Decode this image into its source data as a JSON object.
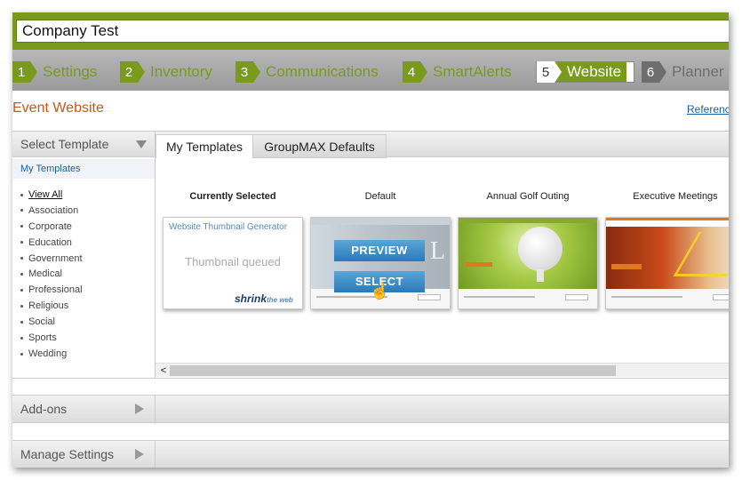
{
  "company": {
    "value": "Company Test"
  },
  "steps": [
    {
      "num": "1",
      "label": "Settings"
    },
    {
      "num": "2",
      "label": "Inventory"
    },
    {
      "num": "3",
      "label": "Communications"
    },
    {
      "num": "4",
      "label": "SmartAlerts"
    },
    {
      "num": "5",
      "label": "Website"
    },
    {
      "num": "6",
      "label": "Planner"
    }
  ],
  "page": {
    "title": "Event Website",
    "reference_link": "Reference"
  },
  "left_panel": {
    "header": "Select Template",
    "subheader": "My Templates",
    "categories": [
      "View All",
      "Association",
      "Corporate",
      "Education",
      "Government",
      "Medical",
      "Professional",
      "Religious",
      "Social",
      "Sports",
      "Wedding"
    ]
  },
  "tabs": [
    {
      "label": "My Templates"
    },
    {
      "label": "GroupMAX Defaults"
    }
  ],
  "templates": [
    {
      "label": "Currently Selected",
      "thumb_title": "Website Thumbnail Generator",
      "thumb_status": "Thumbnail queued",
      "logo_main": "shrink",
      "logo_sub": "the web"
    },
    {
      "label": "Default",
      "letter": "L",
      "preview_label": "PREVIEW",
      "select_label": "SELECT"
    },
    {
      "label": "Annual Golf Outing"
    },
    {
      "label": "Executive Meetings"
    }
  ],
  "scrollbar": {
    "left_arrow": "<"
  },
  "accordion": [
    {
      "label": "Add-ons"
    },
    {
      "label": "Manage Settings"
    }
  ],
  "colors": {
    "brand_green": "#7a9a1e",
    "title_orange": "#c8581a",
    "link_blue": "#1a5fa8",
    "button_blue": "#2a7ab8"
  }
}
